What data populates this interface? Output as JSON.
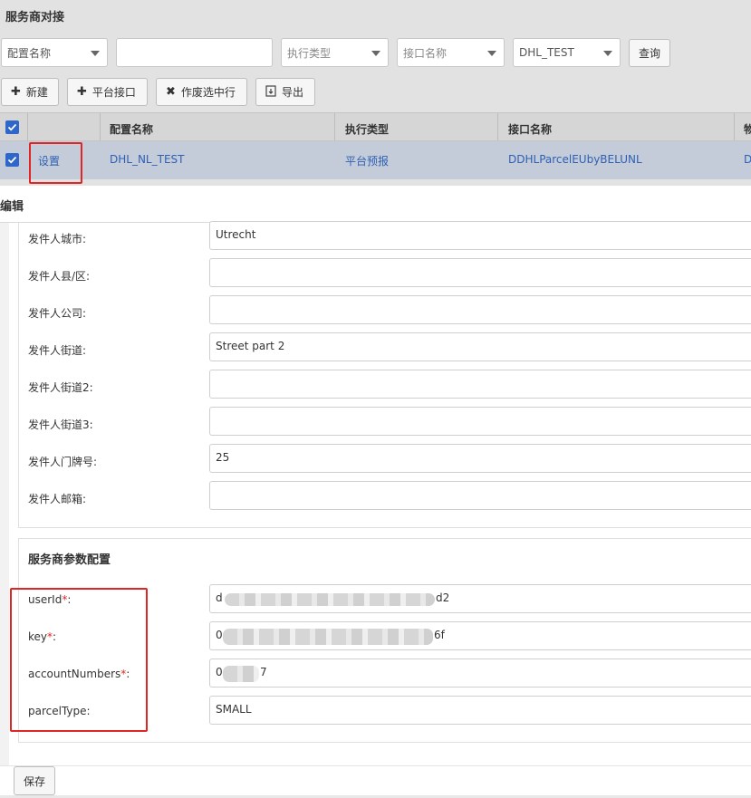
{
  "page": {
    "title": "服务商对接"
  },
  "filters": {
    "config_name": "配置名称",
    "text_value": "",
    "exec_type": "执行类型",
    "interface_name": "接口名称",
    "account": "DHL_TEST",
    "query_label": "查询"
  },
  "toolbar": {
    "new_label": "新建",
    "platform_label": "平台接口",
    "void_label": "作废选中行",
    "export_label": "导出"
  },
  "table": {
    "headers": [
      "配置名称",
      "执行类型",
      "接口名称",
      "物"
    ],
    "row": {
      "action": "设置",
      "config_name": "DHL_NL_TEST",
      "exec_type": "平台预报",
      "interface_name": "DDHLParcelEUbyBELUNL",
      "extra": "D"
    }
  },
  "dialog": {
    "title": "编辑",
    "sender_fields": [
      {
        "label": "发件人城市:",
        "value": "Utrecht"
      },
      {
        "label": "发件人县/区:",
        "value": ""
      },
      {
        "label": "发件人公司:",
        "value": ""
      },
      {
        "label": "发件人街道:",
        "value": "Street part 2"
      },
      {
        "label": "发件人街道2:",
        "value": ""
      },
      {
        "label": "发件人街道3:",
        "value": ""
      },
      {
        "label": "发件人门牌号:",
        "value": "25"
      },
      {
        "label": "发件人邮箱:",
        "value": ""
      }
    ],
    "params_title": "服务商参数配置",
    "params": [
      {
        "label": "userId",
        "req": "*",
        "colon": ":",
        "value": "d",
        "value_end": "d2"
      },
      {
        "label": "key",
        "req": "*",
        "colon": ":",
        "value": "0",
        "value_end": "6f"
      },
      {
        "label": "accountNumbers",
        "req": "*",
        "colon": ":",
        "value": "0",
        "value_end": "7"
      },
      {
        "label": "parcelType",
        "req": "",
        "colon": ":",
        "value": "SMALL",
        "value_end": ""
      }
    ],
    "save_label": "保存"
  },
  "colors": {
    "highlight_red": "#e02525",
    "checkbox_blue": "#2f66c9",
    "link_blue": "#2f5fb3",
    "selected_row": "#c3ccd8"
  }
}
